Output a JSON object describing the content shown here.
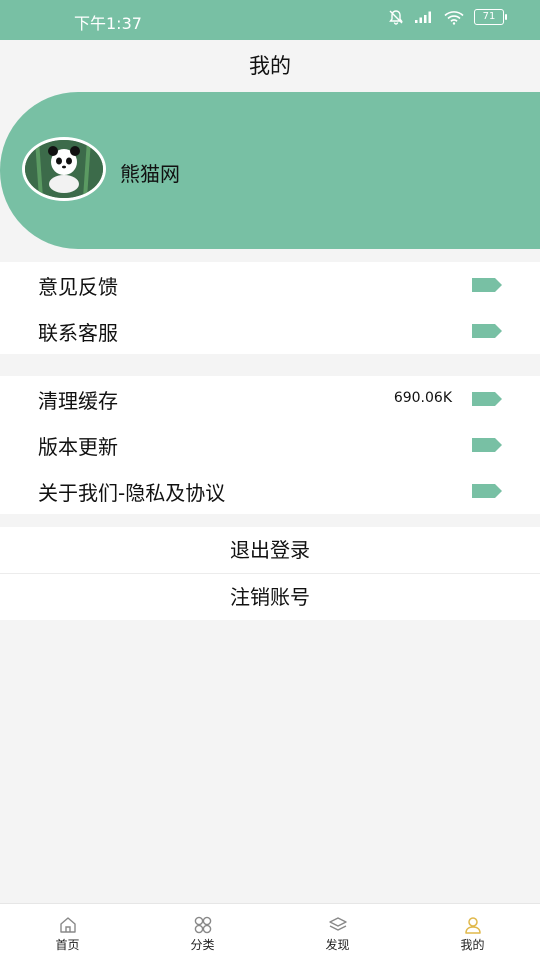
{
  "status_bar": {
    "time": "下午1:37",
    "battery": "71"
  },
  "header": {
    "title": "我的"
  },
  "profile": {
    "name": "熊猫网",
    "avatar_icon": "panda-avatar-icon"
  },
  "menu_group_1": [
    {
      "label": "意见反馈"
    },
    {
      "label": "联系客服"
    }
  ],
  "menu_group_2": [
    {
      "label": "清理缓存",
      "value": "690.06K"
    },
    {
      "label": "版本更新"
    },
    {
      "label": "关于我们-隐私及协议"
    }
  ],
  "actions": {
    "logout": "退出登录",
    "delete_account": "注销账号"
  },
  "bottom_nav": [
    {
      "label": "首页",
      "icon": "home-icon"
    },
    {
      "label": "分类",
      "icon": "category-icon"
    },
    {
      "label": "发现",
      "icon": "layers-icon"
    },
    {
      "label": "我的",
      "icon": "user-icon",
      "active": true
    }
  ],
  "colors": {
    "accent": "#78c0a4",
    "active_icon": "#e0b84a"
  }
}
